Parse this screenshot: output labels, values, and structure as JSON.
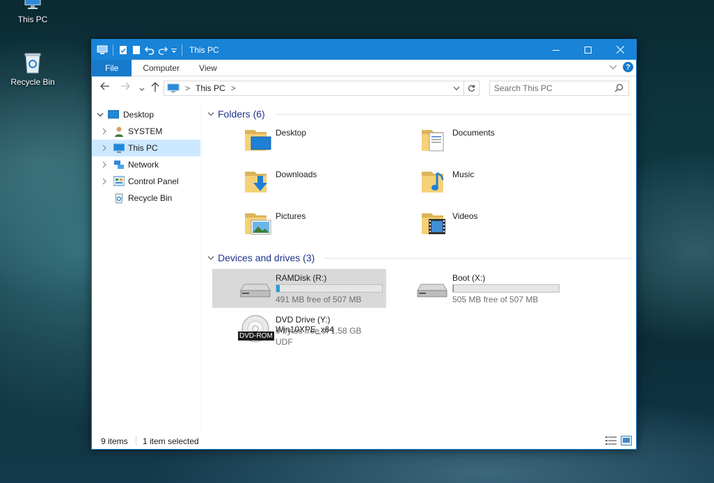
{
  "desktop": {
    "icons": [
      {
        "label": "This PC",
        "icon": "this-pc-icon"
      },
      {
        "label": "Recycle Bin",
        "icon": "recycle-bin-icon"
      }
    ]
  },
  "window": {
    "title": "This PC",
    "ribbon_tabs": [
      "File",
      "Computer",
      "View"
    ],
    "address": {
      "crumb_separator": ">",
      "location": "This PC"
    },
    "search": {
      "placeholder": "Search This PC"
    },
    "nav_tree": [
      {
        "label": "Desktop",
        "icon": "desktop-icon",
        "expanded": true
      },
      {
        "label": "SYSTEM",
        "icon": "user-icon"
      },
      {
        "label": "This PC",
        "icon": "this-pc-icon",
        "selected": true
      },
      {
        "label": "Network",
        "icon": "network-icon"
      },
      {
        "label": "Control Panel",
        "icon": "control-panel-icon"
      },
      {
        "label": "Recycle Bin",
        "icon": "recycle-bin-icon"
      }
    ],
    "folders_group": "Folders (6)",
    "folders": [
      {
        "name": "Desktop",
        "icon": "desktop-folder-icon"
      },
      {
        "name": "Documents",
        "icon": "documents-folder-icon"
      },
      {
        "name": "Downloads",
        "icon": "downloads-folder-icon"
      },
      {
        "name": "Music",
        "icon": "music-folder-icon"
      },
      {
        "name": "Pictures",
        "icon": "pictures-folder-icon"
      },
      {
        "name": "Videos",
        "icon": "videos-folder-icon"
      }
    ],
    "drives_group": "Devices and drives (3)",
    "drives": [
      {
        "name": "RAMDisk (R:)",
        "free": "491 MB free of 507 MB",
        "used_fraction": 0.03,
        "selected": true
      },
      {
        "name": "Boot (X:)",
        "free": "505 MB free of 507 MB",
        "used_fraction": 0.004
      },
      {
        "name": "DVD Drive (Y:) Win10XPE_x64",
        "free": "0 bytes free of 1.58 GB",
        "fs": "UDF",
        "badge": "DVD-ROM"
      }
    ],
    "status": {
      "items": "9 items",
      "selected": "1 item selected"
    }
  },
  "colors": {
    "accent": "#1883d7",
    "selection": "#cce8ff",
    "group_title": "#1e3287",
    "progress": "#26a0da"
  }
}
